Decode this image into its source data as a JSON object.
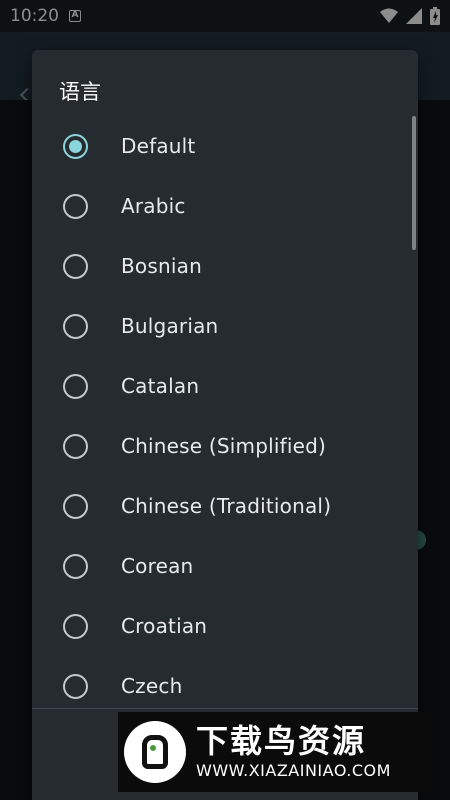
{
  "status_bar": {
    "time": "10:20",
    "notification_glyph": "A",
    "icons": [
      "wifi-icon",
      "signal-icon",
      "battery-icon"
    ]
  },
  "dialog": {
    "title": "语言",
    "selected": "Default",
    "options": [
      "Default",
      "Arabic",
      "Bosnian",
      "Bulgarian",
      "Catalan",
      "Chinese (Simplified)",
      "Chinese (Traditional)",
      "Corean",
      "Croatian",
      "Czech"
    ]
  },
  "watermark": {
    "title": "下载鸟资源",
    "url": "WWW.XIAZAINIAO.COM"
  },
  "colors": {
    "accent": "#8bd3dd",
    "dialog_bg": "#262b2f",
    "app_bar": "#24343c"
  }
}
